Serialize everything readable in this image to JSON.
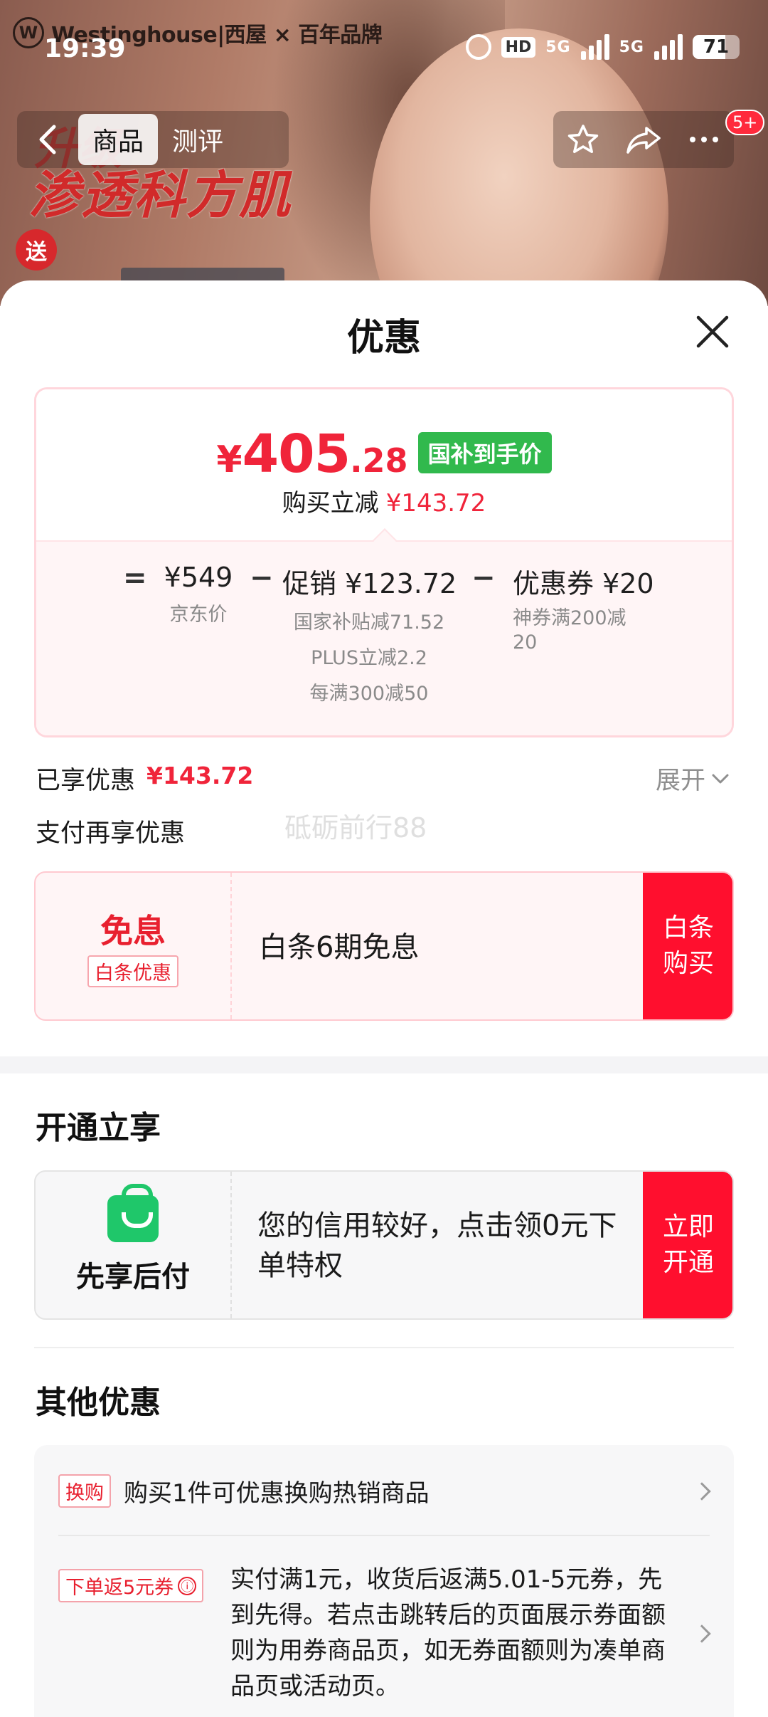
{
  "banner": {
    "brand_logo": "W",
    "brand_text": "Westinghouse|西屋 × 百年品牌",
    "promo_title_top": "升级",
    "promo_title": "渗透科方肌",
    "gift_badge": "送"
  },
  "status_bar": {
    "time": "19:39",
    "hd": "HD",
    "sig1": "5G",
    "sig2": "5G",
    "battery": "71"
  },
  "nav": {
    "tabs": [
      {
        "label": "商品",
        "active": true
      },
      {
        "label": "测评",
        "active": false
      }
    ],
    "badge": "5+",
    "icons": [
      "back-icon",
      "star-icon",
      "share-icon",
      "more-icon"
    ]
  },
  "sheet": {
    "title": "优惠"
  },
  "price_card": {
    "final_price_yen": "¥",
    "final_price_int": "405",
    "final_price_dec": ".28",
    "subsidy_tag": "国补到手价",
    "reduce_label": "购买立减",
    "reduce_amount": "¥143.72",
    "breakdown": [
      {
        "op": "=",
        "value": "¥549",
        "subs": [
          "京东价"
        ]
      },
      {
        "op": "−",
        "value": "促销 ¥123.72",
        "subs": [
          "国家补贴减71.52",
          "PLUS立减2.2",
          "每满300减50"
        ]
      },
      {
        "op": "−",
        "value": "优惠券 ¥20",
        "subs": [
          "神券满200减",
          "20"
        ]
      }
    ]
  },
  "enjoyed": {
    "label": "已享优惠",
    "amount": "¥143.72",
    "expand_label": "展开"
  },
  "pay_more": {
    "label": "支付再享优惠",
    "watermark": "砥砺前行88"
  },
  "offer": {
    "big": "免息",
    "tag": "白条优惠",
    "text": "白条6期免息",
    "button_line1": "白条",
    "button_line2": "购买"
  },
  "open_enjoy": {
    "title": "开通立享",
    "name": "先享后付",
    "text": "您的信用较好，点击领0元下单特权",
    "button_line1": "立即",
    "button_line2": "开通"
  },
  "other": {
    "title": "其他优惠",
    "items": [
      {
        "tag": "换购",
        "text": "购买1件可优惠换购热销商品"
      },
      {
        "tag": "下单返5元券",
        "info_icon": "ⓘ",
        "text": "实付满1元，收货后返满5.01-5元券，先到先得。若点击跳转后的页面展示券面额则为用券商品页，如无券面额则为凑单商品页或活动页。"
      }
    ]
  },
  "colors": {
    "accent_red": "#f0243a",
    "button_red": "#ff0f2e",
    "subsidy_green": "#31b94d",
    "credit_green": "#1fc76a"
  }
}
